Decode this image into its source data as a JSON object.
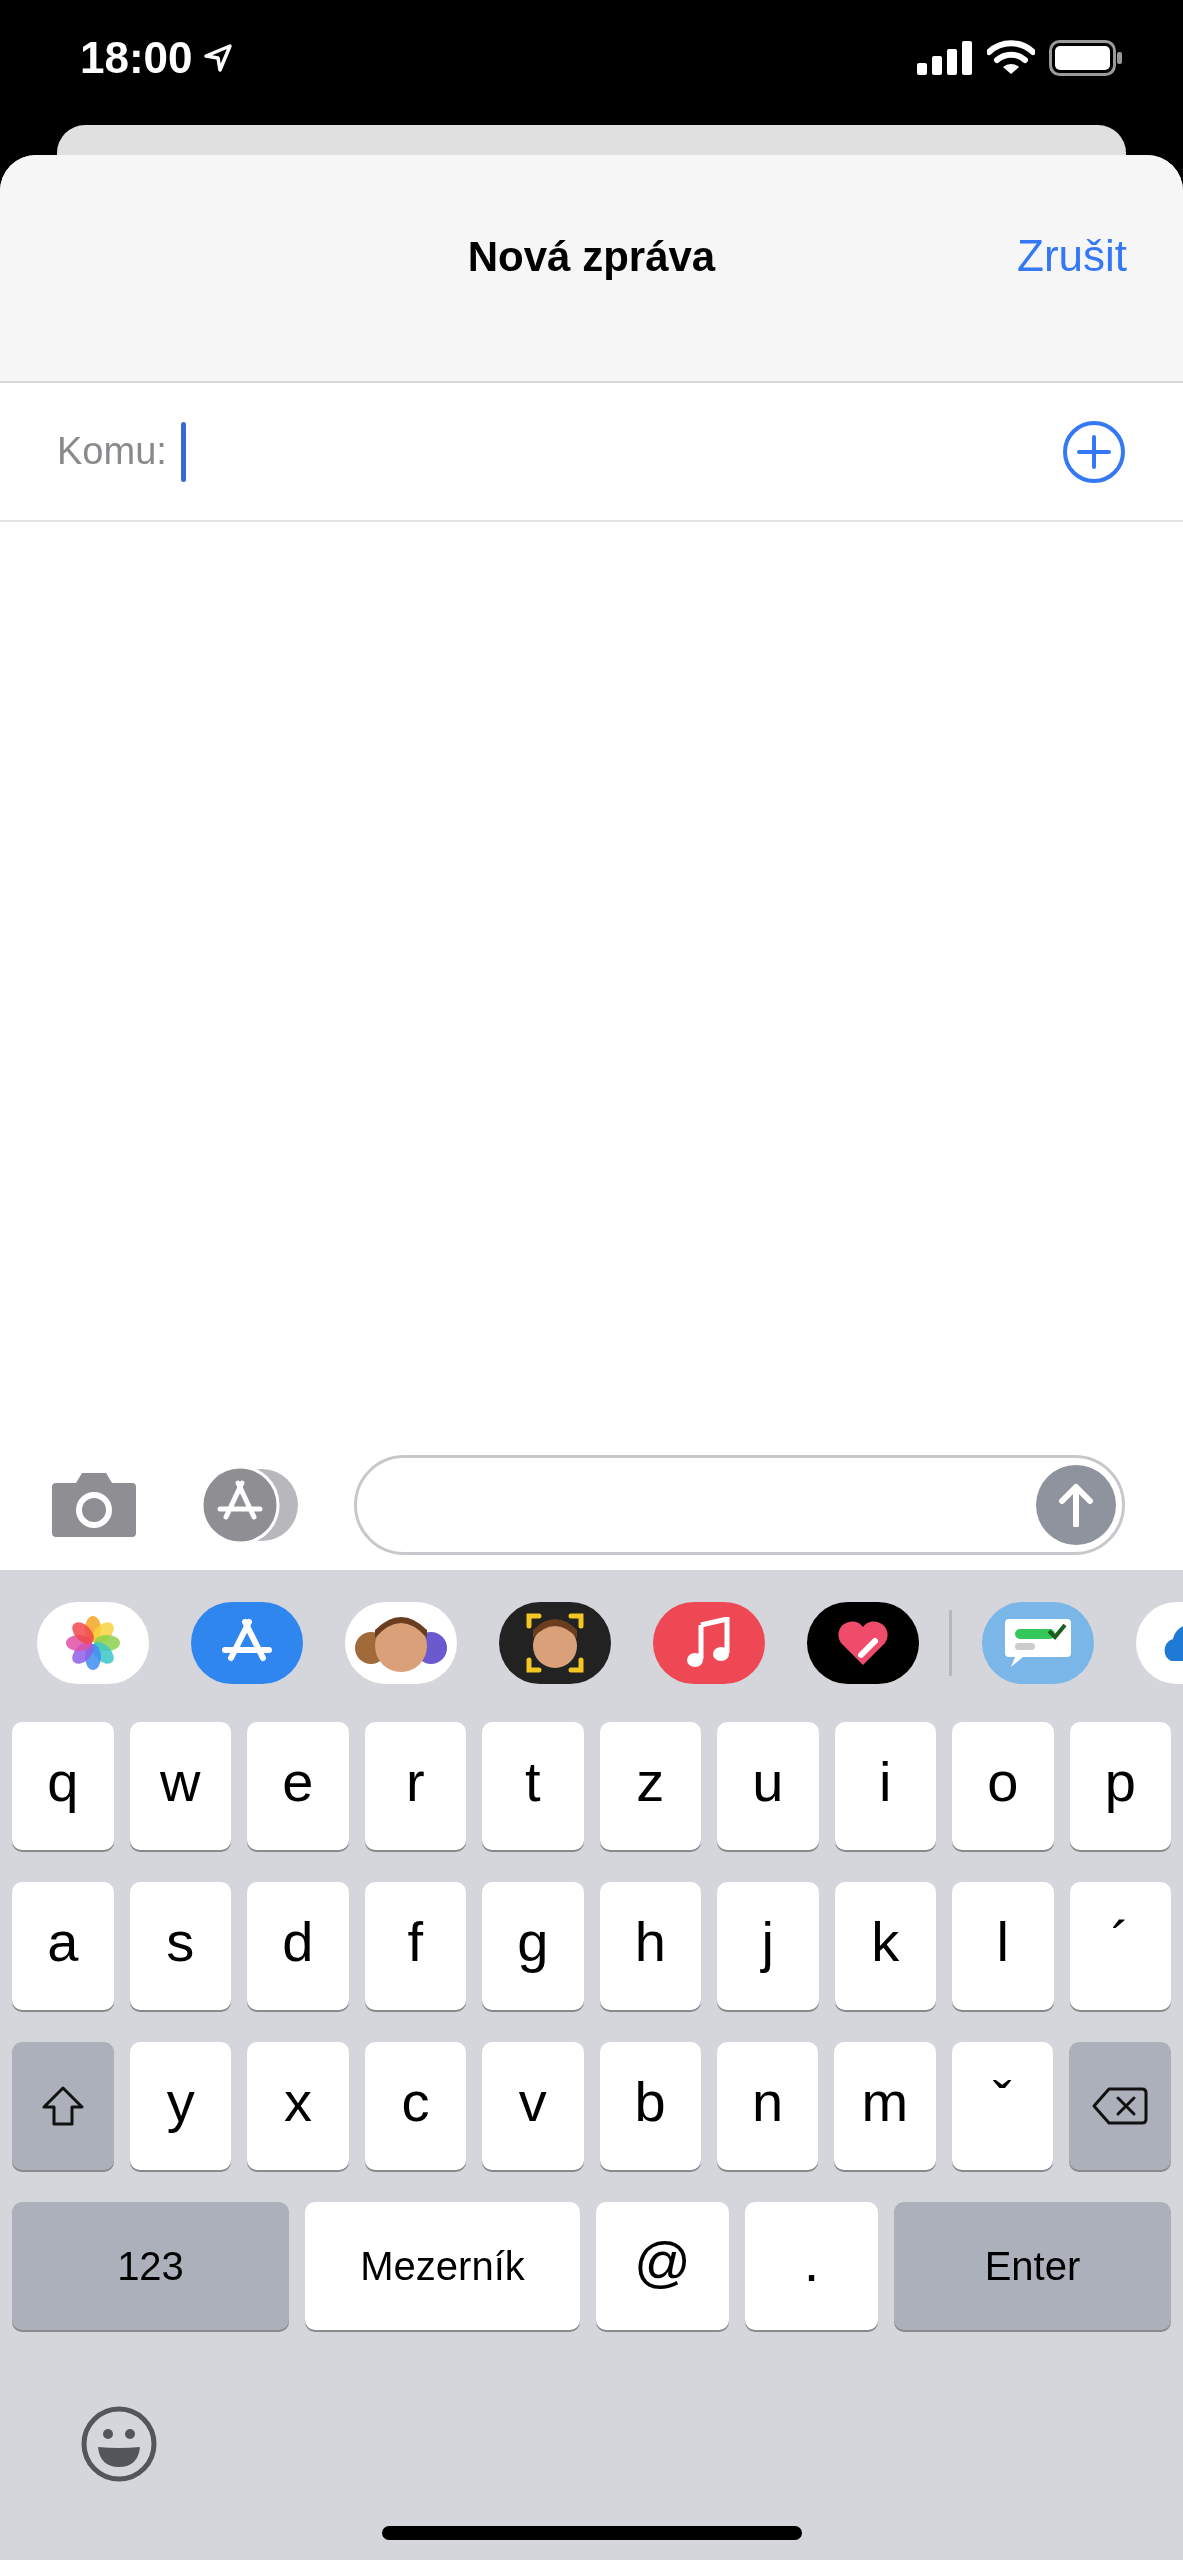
{
  "status_bar": {
    "time": "18:00"
  },
  "header": {
    "title": "Nová zpráva",
    "cancel": "Zrušit"
  },
  "recipient_field": {
    "label": "Komu:",
    "focused": true
  },
  "keyboard": {
    "letter_rows": [
      [
        {
          "kind": "letter",
          "label": "q"
        },
        {
          "kind": "letter",
          "label": "w"
        },
        {
          "kind": "letter",
          "label": "e"
        },
        {
          "kind": "letter",
          "label": "r"
        },
        {
          "kind": "letter",
          "label": "t"
        },
        {
          "kind": "letter",
          "label": "z"
        },
        {
          "kind": "letter",
          "label": "u"
        },
        {
          "kind": "letter",
          "label": "i"
        },
        {
          "kind": "letter",
          "label": "o"
        },
        {
          "kind": "letter",
          "label": "p"
        }
      ],
      [
        {
          "kind": "letter",
          "label": "a"
        },
        {
          "kind": "letter",
          "label": "s"
        },
        {
          "kind": "letter",
          "label": "d"
        },
        {
          "kind": "letter",
          "label": "f"
        },
        {
          "kind": "letter",
          "label": "g"
        },
        {
          "kind": "letter",
          "label": "h"
        },
        {
          "kind": "letter",
          "label": "j"
        },
        {
          "kind": "letter",
          "label": "k"
        },
        {
          "kind": "letter",
          "label": "l"
        },
        {
          "kind": "letter",
          "label": "´"
        }
      ],
      [
        {
          "kind": "shift"
        },
        {
          "kind": "letter",
          "label": "y"
        },
        {
          "kind": "letter",
          "label": "x"
        },
        {
          "kind": "letter",
          "label": "c"
        },
        {
          "kind": "letter",
          "label": "v"
        },
        {
          "kind": "letter",
          "label": "b"
        },
        {
          "kind": "letter",
          "label": "n"
        },
        {
          "kind": "letter",
          "label": "m"
        },
        {
          "kind": "letter",
          "label": "ˇ"
        },
        {
          "kind": "backspace"
        }
      ]
    ],
    "bottom_row": [
      {
        "kind": "function",
        "label": "123"
      },
      {
        "kind": "space",
        "label": "Mezerník"
      },
      {
        "kind": "letter",
        "label": "@"
      },
      {
        "kind": "letter",
        "label": "."
      },
      {
        "kind": "function",
        "label": "Enter"
      }
    ]
  }
}
